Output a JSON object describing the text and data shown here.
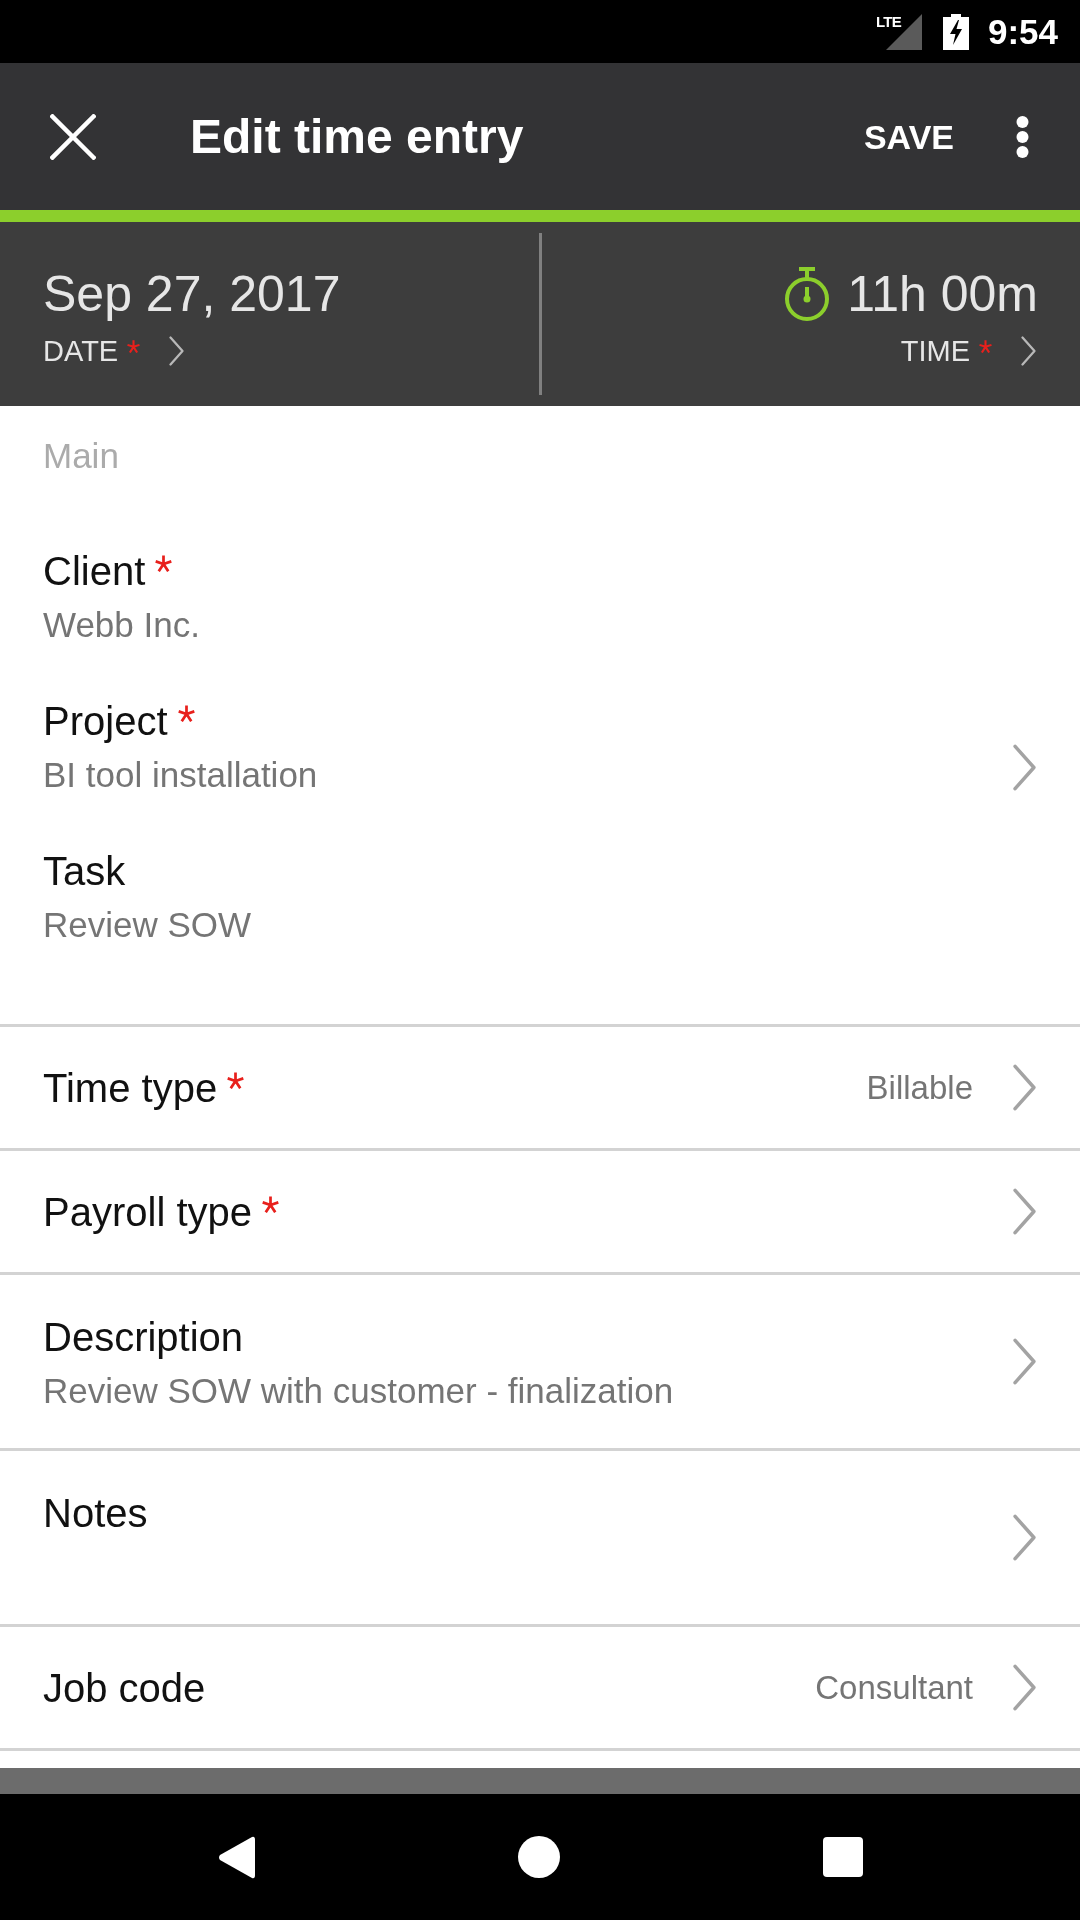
{
  "status_bar": {
    "network": "LTE",
    "time": "9:54"
  },
  "toolbar": {
    "title": "Edit time entry",
    "action": "SAVE"
  },
  "header": {
    "date": {
      "value": "Sep 27, 2017",
      "label": "DATE",
      "required": true
    },
    "time": {
      "value": "11h 00m",
      "label": "TIME",
      "required": true
    }
  },
  "section": {
    "title": "Main",
    "fields": [
      {
        "label": "Client",
        "value": "Webb Inc.",
        "required": true,
        "navigable": false
      },
      {
        "label": "Project",
        "value": "BI tool installation",
        "required": true,
        "navigable": true
      },
      {
        "label": "Task",
        "value": "Review SOW",
        "required": false,
        "navigable": false
      }
    ]
  },
  "rows": [
    {
      "kind": "inline",
      "label": "Time type",
      "value": "Billable",
      "required": true
    },
    {
      "kind": "inline",
      "label": "Payroll type",
      "required": true
    },
    {
      "kind": "stacked",
      "label": "Description",
      "value": "Review SOW with customer - finalization",
      "required": false
    },
    {
      "kind": "stacked",
      "label": "Notes",
      "required": false
    },
    {
      "kind": "inline",
      "label": "Job code",
      "value": "Consultant",
      "required": false
    }
  ]
}
